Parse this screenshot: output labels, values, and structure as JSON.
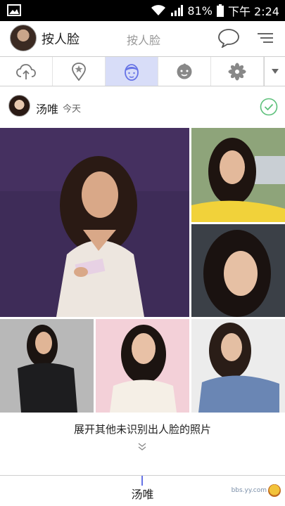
{
  "status_bar": {
    "battery": "81%",
    "time": "下午 2:24",
    "icons": [
      "image-icon",
      "wifi-icon",
      "signal-icon",
      "battery-icon"
    ]
  },
  "header": {
    "title": "按人脸",
    "subtitle": "按人脸",
    "icons": [
      "chat-bubble-icon",
      "menu-icon"
    ]
  },
  "tabs": [
    {
      "icon": "cloud-upload-icon",
      "active": false
    },
    {
      "icon": "location-star-icon",
      "active": false
    },
    {
      "icon": "face-icon",
      "active": true
    },
    {
      "icon": "baby-face-icon",
      "active": false
    },
    {
      "icon": "pinwheel-icon",
      "active": false
    }
  ],
  "person": {
    "name": "汤唯",
    "date": "今天"
  },
  "expand": {
    "label": "展开其他未识别出人脸的照片"
  },
  "bottom_bar": {
    "label": "汤唯",
    "watermark": "bbs.yy.com"
  },
  "colors": {
    "accent": "#6673e6",
    "active_tab_bg": "#d8ddf8",
    "check_green": "#5cc07a"
  }
}
